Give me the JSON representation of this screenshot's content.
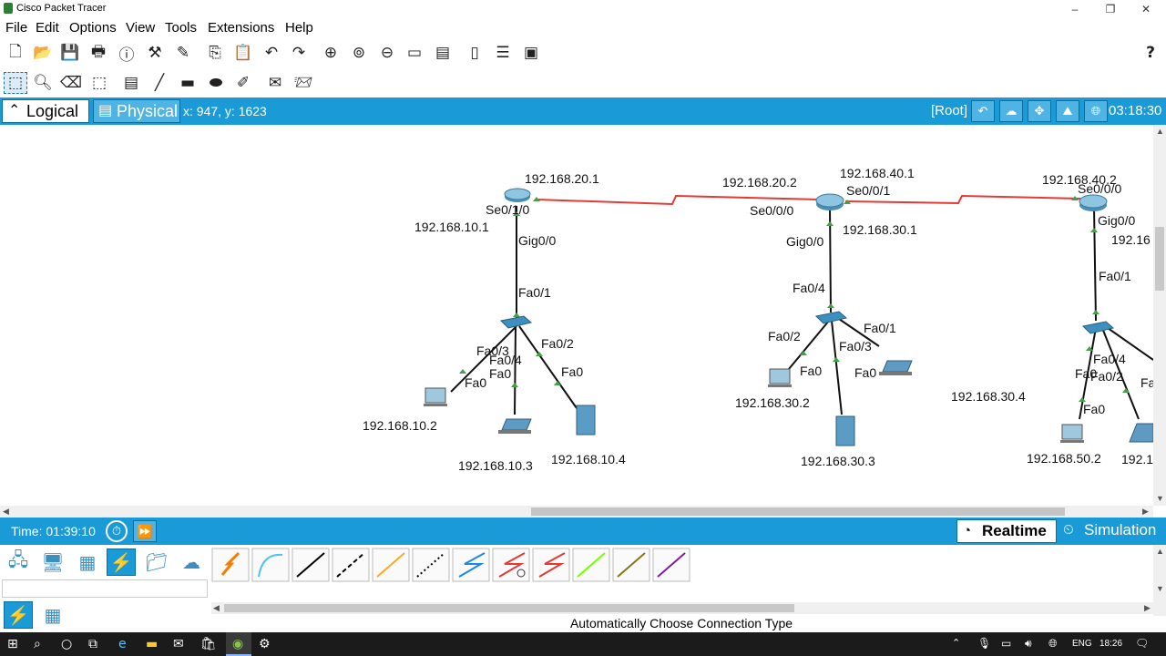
{
  "window": {
    "title": "Cisco Packet Tracer"
  },
  "menu": [
    "File",
    "Edit",
    "Options",
    "View",
    "Tools",
    "Extensions",
    "Help"
  ],
  "toolbar1_icons": [
    "new-file-icon",
    "open-folder-icon",
    "save-icon",
    "print-icon",
    "info-icon",
    "network-wizard-icon",
    "activity-wizard-icon",
    "copy-icon",
    "paste-icon",
    "undo-icon",
    "redo-icon",
    "zoom-in-icon",
    "zoom-reset-icon",
    "zoom-out-icon",
    "drawing-palette-icon",
    "custom-devices-icon",
    "pdu-list-icon",
    "cluster-icon",
    "viewport-icon"
  ],
  "toolbar2_icons": [
    "select-icon",
    "inspect-icon",
    "delete-icon",
    "resize-icon",
    "note-icon",
    "draw-line-icon",
    "rectangle-icon",
    "ellipse-icon",
    "freeform-icon",
    "simple-pdu-icon",
    "complex-pdu-icon"
  ],
  "workspace_bar": {
    "logical": "Logical",
    "physical": "Physical",
    "coords": "x: 947, y: 1623",
    "root": "[Root]",
    "clock": "03:18:30"
  },
  "topology": {
    "labels": [
      "192.168.20.1",
      "Se0/1/0",
      "192.168.10.1",
      "Gig0/0",
      "Fa0/1",
      "Fa0/2",
      "Fa0/3",
      "Fa0/4",
      "Fa0",
      "Fa0",
      "Fa0",
      "Fa0",
      "192.168.10.2",
      "192.168.10.3",
      "192.168.10.4",
      "192.168.20.2",
      "Se0/0/0",
      "192.168.40.1",
      "Se0/0/1",
      "Gig0/0",
      "192.168.30.1",
      "Fa0/4",
      "Fa0/2",
      "Fa0/1",
      "Fa0/3",
      "Fa0",
      "192.168.30.2",
      "192.168.30.3",
      "192.168.30.4",
      "192.168.40.2",
      "Se0/0/0",
      "Gig0/0",
      "192.16",
      "Fa0/1",
      "Fa0/4",
      "Fa0/2",
      "Fa0",
      "Fa0",
      "Fa",
      "192.168.50.2",
      "192.1"
    ]
  },
  "timebar": {
    "time": "Time: 01:39:10",
    "realtime": "Realtime",
    "simulation": "Simulation"
  },
  "status": "Automatically Choose Connection Type",
  "taskbar": {
    "lang": "ENG",
    "time": "18:26"
  }
}
